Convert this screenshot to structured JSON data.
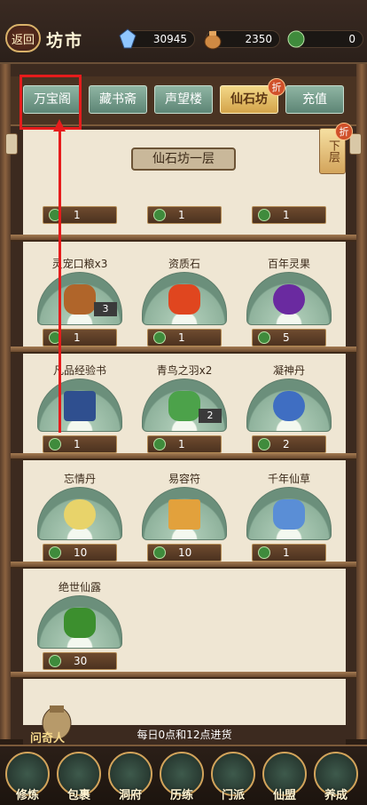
{
  "header": {
    "back_label": "返回",
    "title": "坊市",
    "resources": [
      {
        "name": "spirit-crystal",
        "value": "30945"
      },
      {
        "name": "bag-gold",
        "value": "2350"
      },
      {
        "name": "green-coin",
        "value": "0"
      }
    ]
  },
  "tabs": [
    {
      "label": "万宝阁",
      "active": false
    },
    {
      "label": "藏书斋",
      "active": false
    },
    {
      "label": "声望楼",
      "active": false
    },
    {
      "label": "仙石坊",
      "active": true,
      "badge": "折"
    },
    {
      "label": "充值",
      "active": false
    }
  ],
  "floor": {
    "current": "仙石坊一层",
    "next_label": "下层",
    "next_badge": "折"
  },
  "items_row0": [
    {
      "price": "1"
    },
    {
      "price": "1"
    },
    {
      "price": "1"
    }
  ],
  "items": [
    {
      "name": "灵宠口粮x3",
      "qty": "3",
      "price": "1",
      "color": "#b0652a"
    },
    {
      "name": "资质石",
      "qty": "",
      "price": "1",
      "color": "#e0461f"
    },
    {
      "name": "百年灵果",
      "qty": "",
      "price": "5",
      "color": "#6a2aa0"
    },
    {
      "name": "凡品经验书",
      "qty": "",
      "price": "1",
      "color": "#2f4f8f"
    },
    {
      "name": "青鸟之羽x2",
      "qty": "2",
      "price": "1",
      "color": "#4ca24a"
    },
    {
      "name": "凝神丹",
      "qty": "",
      "price": "2",
      "color": "#3f6ec2"
    },
    {
      "name": "忘情丹",
      "qty": "",
      "price": "10",
      "color": "#e8d36a"
    },
    {
      "name": "易容符",
      "qty": "",
      "price": "10",
      "color": "#e2a13c"
    },
    {
      "name": "千年仙草",
      "qty": "",
      "price": "1",
      "color": "#5a8ed6"
    },
    {
      "name": "绝世仙露",
      "qty": "",
      "price": "30",
      "color": "#3c8f2e"
    }
  ],
  "footer": {
    "npc_label": "问奇人",
    "restock_note": "每日0点和12点进货"
  },
  "nav": [
    {
      "label": "修炼"
    },
    {
      "label": "包裹"
    },
    {
      "label": "洞府"
    },
    {
      "label": "历练"
    },
    {
      "label": "门派"
    },
    {
      "label": "仙盟"
    },
    {
      "label": "养成"
    }
  ],
  "colors": {
    "accent": "#d3a45b",
    "tab": "#7aa291",
    "active_tab": "#e8c26b",
    "highlight": "#e61c1c"
  }
}
